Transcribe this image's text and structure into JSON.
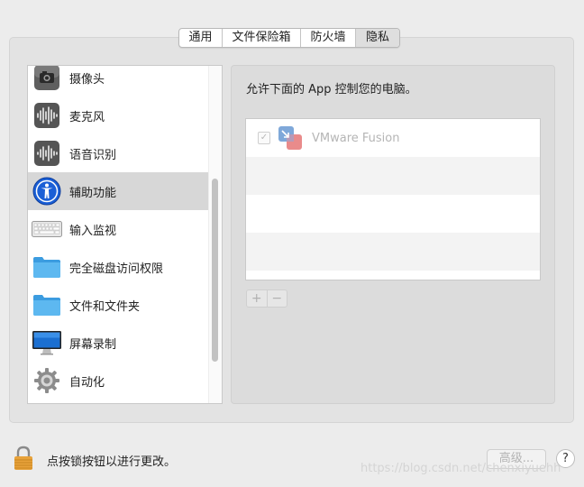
{
  "tabs": [
    {
      "label": "通用",
      "active": false
    },
    {
      "label": "文件保险箱",
      "active": false
    },
    {
      "label": "防火墙",
      "active": false
    },
    {
      "label": "隐私",
      "active": true
    }
  ],
  "sidebar": {
    "items": [
      {
        "label": "摄像头",
        "icon": "camera-icon",
        "selected": false
      },
      {
        "label": "麦克风",
        "icon": "microphone-icon",
        "selected": false
      },
      {
        "label": "语音识别",
        "icon": "speech-recognition-icon",
        "selected": false
      },
      {
        "label": "辅助功能",
        "icon": "accessibility-icon",
        "selected": true
      },
      {
        "label": "输入监视",
        "icon": "keyboard-icon",
        "selected": false
      },
      {
        "label": "完全磁盘访问权限",
        "icon": "folder-icon",
        "selected": false
      },
      {
        "label": "文件和文件夹",
        "icon": "folder-icon",
        "selected": false
      },
      {
        "label": "屏幕录制",
        "icon": "display-icon",
        "selected": false
      },
      {
        "label": "自动化",
        "icon": "gear-icon",
        "selected": false
      }
    ]
  },
  "main": {
    "description": "允许下面的 App 控制您的电脑。",
    "apps": [
      {
        "name": "VMware Fusion",
        "checked": true,
        "icon": "vmware-fusion-icon"
      }
    ],
    "add_label": "+",
    "remove_label": "−"
  },
  "footer": {
    "lock_text": "点按锁按钮以进行更改。",
    "advanced_label": "高级...",
    "help_label": "?",
    "watermark": "https://blog.csdn.net/chenxiyuehh"
  },
  "colors": {
    "accent_blue": "#1a5fd6",
    "folder_blue": "#4aa8e8",
    "lock_orange": "#e8a23a"
  }
}
